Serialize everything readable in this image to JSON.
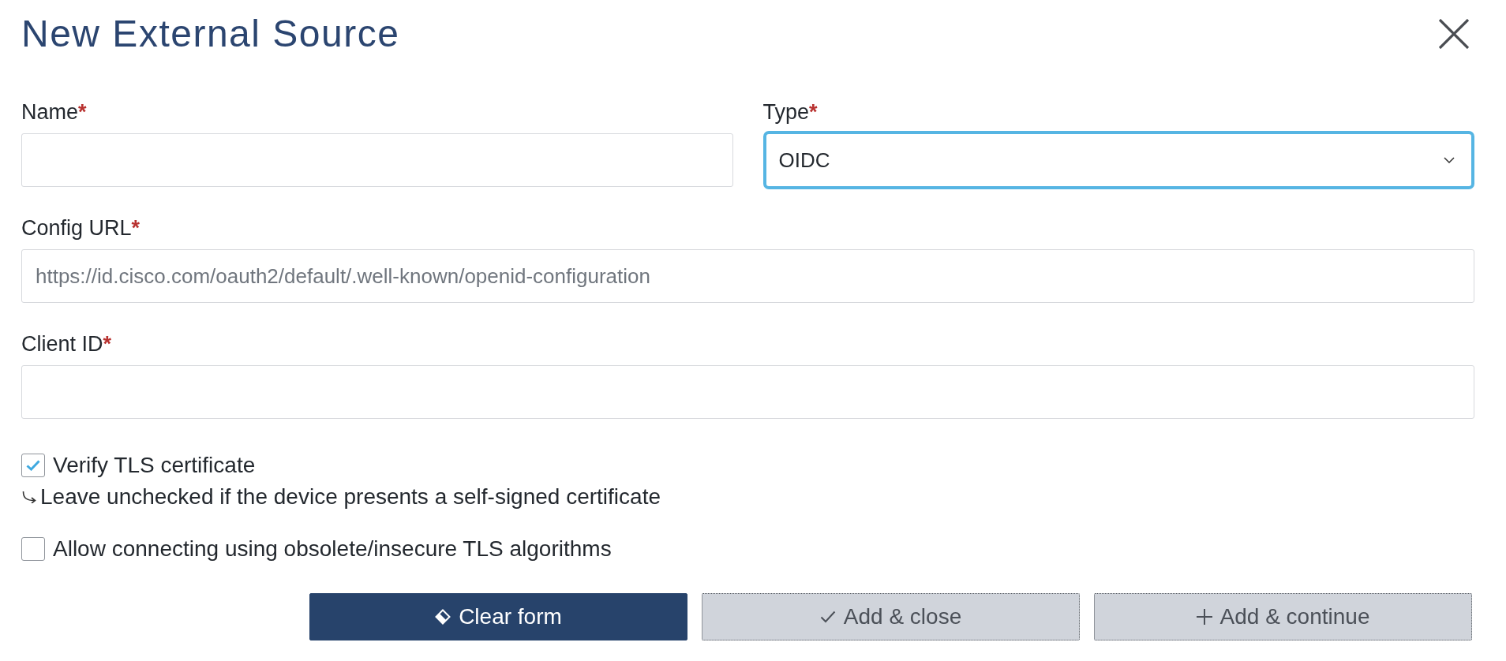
{
  "dialog": {
    "title": "New External Source"
  },
  "rows": [
    {
      "fields": [
        {
          "kind": "text",
          "label": "Name",
          "marker": "*",
          "focused": false
        },
        {
          "kind": "select",
          "label": "Type",
          "marker": "*",
          "value": "OIDC",
          "focused": true
        }
      ]
    },
    {
      "fields": [
        {
          "kind": "text",
          "label": "Config URL",
          "marker": "*",
          "placeholder": "https://id.cisco.com/oauth2/default/.well-known/openid-configuration",
          "focused": false
        }
      ]
    },
    {
      "fields": [
        {
          "kind": "text",
          "label": "Client ID",
          "marker": "*",
          "focused": false
        }
      ]
    }
  ],
  "options": [
    {
      "label": "Verify TLS certificate",
      "checked": true,
      "hint": "Leave unchecked if the device presents a self-signed certificate"
    },
    {
      "label": "Allow connecting using obsolete/insecure TLS algorithms",
      "checked": false
    }
  ],
  "buttons": [
    {
      "kind": "clear",
      "label": "Clear form",
      "disabled": false
    },
    {
      "kind": "close",
      "label": "Add & close",
      "disabled": true
    },
    {
      "kind": "continue",
      "label": "Add & continue",
      "disabled": true
    }
  ]
}
